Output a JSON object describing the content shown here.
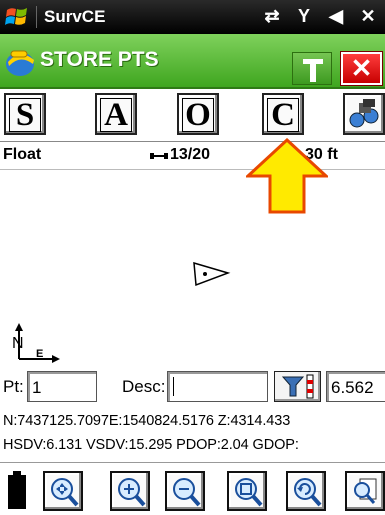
{
  "titlebar": {
    "app_title": "SurvCE"
  },
  "header": {
    "screen_title": "STORE PTS"
  },
  "mode_buttons": [
    "S",
    "A",
    "O",
    "C"
  ],
  "status": {
    "solution": "Float",
    "satellites": "13/20",
    "distance": "30 ft"
  },
  "point": {
    "pt_label": "Pt:",
    "pt_value": "1",
    "desc_label": "Desc:",
    "desc_value": "",
    "height_value": "6.562"
  },
  "coords": "N:7437125.7097E:1540824.5176 Z:4314.433",
  "quality": "HSDV:6.131 VSDV:15.295 PDOP:2.04 GDOP:",
  "map": {
    "north_label": "N"
  },
  "colors": {
    "header_green": "#3fa61f",
    "close_red": "#e00000",
    "arrow_yellow": "#ffea00"
  }
}
